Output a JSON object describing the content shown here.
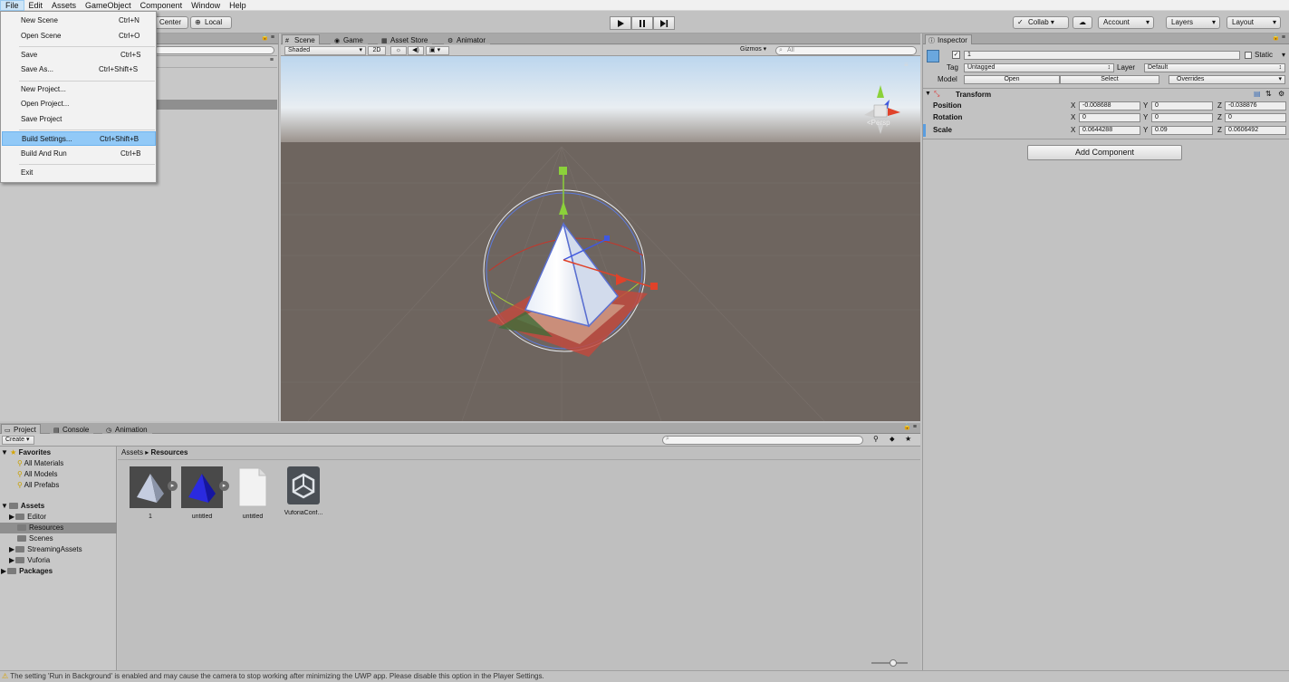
{
  "menubar": {
    "items": [
      "File",
      "Edit",
      "Assets",
      "GameObject",
      "Component",
      "Window",
      "Help"
    ]
  },
  "toolbar": {
    "pivot_center": "Center",
    "pivot_local": "Local",
    "collab": "Collab",
    "account": "Account",
    "layers": "Layers",
    "layout": "Layout"
  },
  "file_menu": {
    "items": [
      {
        "label": "New Scene",
        "shortcut": "Ctrl+N"
      },
      {
        "label": "Open Scene",
        "shortcut": "Ctrl+O"
      },
      {
        "label": "Save",
        "shortcut": "Ctrl+S"
      },
      {
        "label": "Save As...",
        "shortcut": "Ctrl+Shift+S"
      },
      {
        "label": "New Project...",
        "shortcut": ""
      },
      {
        "label": "Open Project...",
        "shortcut": ""
      },
      {
        "label": "Save Project",
        "shortcut": ""
      },
      {
        "label": "Build Settings...",
        "shortcut": "Ctrl+Shift+B"
      },
      {
        "label": "Build And Run",
        "shortcut": "Ctrl+B"
      },
      {
        "label": "Exit",
        "shortcut": ""
      }
    ]
  },
  "scene_tabs": [
    "Scene",
    "Game",
    "Asset Store",
    "Animator"
  ],
  "scene_bar": {
    "shading": "Shaded",
    "mode_2d": "2D",
    "gizmos": "Gizmos",
    "search_placeholder": "All"
  },
  "scene_view": {
    "persp_label": "Persp"
  },
  "inspector": {
    "tab": "Inspector",
    "object_name": "1",
    "static_label": "Static",
    "tag_label": "Tag",
    "tag_value": "Untagged",
    "layer_label": "Layer",
    "layer_value": "Default",
    "model_label": "Model",
    "open_btn": "Open",
    "select_btn": "Select",
    "overrides_btn": "Overrides",
    "transform_title": "Transform",
    "position_label": "Position",
    "rotation_label": "Rotation",
    "scale_label": "Scale",
    "axis_x": "X",
    "axis_y": "Y",
    "axis_z": "Z",
    "position": {
      "x": "-0.008688",
      "y": "0",
      "z": "-0.038876"
    },
    "rotation": {
      "x": "0",
      "y": "0",
      "z": "0"
    },
    "scale": {
      "x": "0.0644288",
      "y": "0.09",
      "z": "0.0606492"
    },
    "add_component": "Add Component"
  },
  "project": {
    "tabs": [
      "Project",
      "Console",
      "Animation"
    ],
    "create_btn": "Create",
    "breadcrumb": [
      "Assets",
      "Resources"
    ],
    "tree": {
      "favorites": "Favorites",
      "fav_items": [
        "All Materials",
        "All Models",
        "All Prefabs"
      ],
      "assets": "Assets",
      "asset_folders": [
        "Editor",
        "Resources",
        "Scenes",
        "StreamingAssets",
        "Vuforia"
      ],
      "packages": "Packages"
    },
    "assets": [
      {
        "name": "1"
      },
      {
        "name": "untitled"
      },
      {
        "name": "untitled"
      },
      {
        "name": "VuforiaConf..."
      }
    ]
  },
  "status": {
    "message": "The setting 'Run in Background' is enabled and may cause the camera to stop working after minimizing the UWP app. Please disable this option in the Player Settings."
  }
}
